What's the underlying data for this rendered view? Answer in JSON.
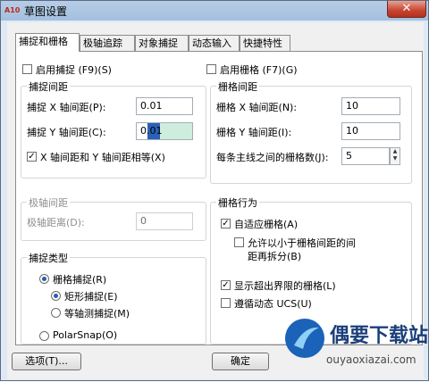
{
  "window": {
    "title": "草图设置",
    "close_symbol": "✕",
    "app_icon_text": "A10"
  },
  "tabs": [
    "捕捉和栅格",
    "极轴追踪",
    "对象捕捉",
    "动态输入",
    "快捷特性"
  ],
  "snap": {
    "enable_label": "启用捕捉 (F9)(S)",
    "spacing_group": "捕捉间距",
    "x_label": "捕捉 X 轴间距(P):",
    "x_value": "0.01",
    "y_label": "捕捉 Y 轴间距(C):",
    "y_value": "0.01",
    "equal_label": "X 轴间距和 Y 轴间距相等(X)",
    "equal_checked": "✓"
  },
  "polar": {
    "group": "极轴间距",
    "distance_label": "极轴距离(D):",
    "distance_value": "0"
  },
  "snap_type": {
    "group": "捕捉类型",
    "grid_snap": "栅格捕捉(R)",
    "rect_snap": "矩形捕捉(E)",
    "iso_snap": "等轴测捕捉(M)",
    "polar_snap": "PolarSnap(O)"
  },
  "grid": {
    "enable_label": "启用栅格 (F7)(G)",
    "spacing_group": "栅格间距",
    "x_label": "栅格 X 轴间距(N):",
    "x_value": "10",
    "y_label": "栅格 Y 轴间距(I):",
    "y_value": "10",
    "major_label": "每条主线之间的栅格数(J):",
    "major_value": "5",
    "spin_up": "▲",
    "spin_down": "▼"
  },
  "grid_behavior": {
    "group": "栅格行为",
    "adaptive": "自适应栅格(A)",
    "subdivide_line1": "允许以小于栅格间距的间",
    "subdivide_line2": "距再拆分(B)",
    "beyond_limits": "显示超出界限的栅格(L)",
    "follow_ucs": "遵循动态 UCS(U)",
    "check": "✓"
  },
  "buttons": {
    "options": "选项(T)...",
    "ok": "确定"
  },
  "watermark": {
    "brand": "偶要下载站",
    "url": "ouyaoxiazai.com"
  }
}
